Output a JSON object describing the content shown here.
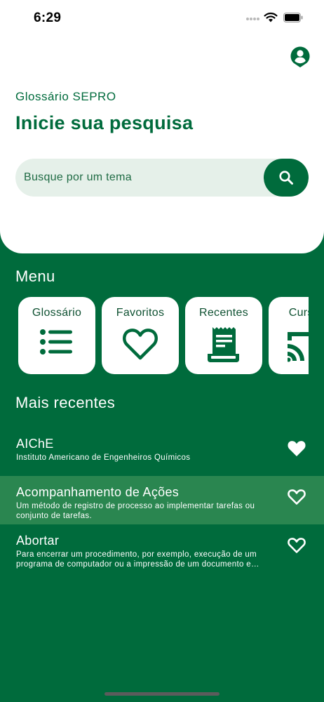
{
  "status_bar": {
    "time": "6:29"
  },
  "header": {
    "app_name": "Glossário SEPRO",
    "title": "Inicie sua pesquisa"
  },
  "search": {
    "placeholder": "Busque por um tema",
    "value": ""
  },
  "menu": {
    "title": "Menu",
    "items": [
      {
        "label": "Glossário",
        "icon": "list-icon"
      },
      {
        "label": "Favoritos",
        "icon": "heart-outline-icon"
      },
      {
        "label": "Recentes",
        "icon": "receipt-icon"
      },
      {
        "label": "Cursos",
        "icon": "cast-icon"
      }
    ]
  },
  "recent": {
    "title": "Mais recentes",
    "items": [
      {
        "title": "AIChE",
        "description": "Instituto Americano de Engenheiros Químicos",
        "favorited": true
      },
      {
        "title": "Acompanhamento de Ações",
        "description": "Um método de registro de processo ao implementar tarefas ou conjunto de tarefas.",
        "favorited": false
      },
      {
        "title": "Abortar",
        "description": "Para encerrar um procedimento, por exemplo, execução de um programa de computador ou a impressão de um documento e…",
        "favorited": false
      }
    ]
  },
  "colors": {
    "primary": "#006B3C",
    "highlight": "#2a8650",
    "search_bg": "#e5f0e9"
  }
}
